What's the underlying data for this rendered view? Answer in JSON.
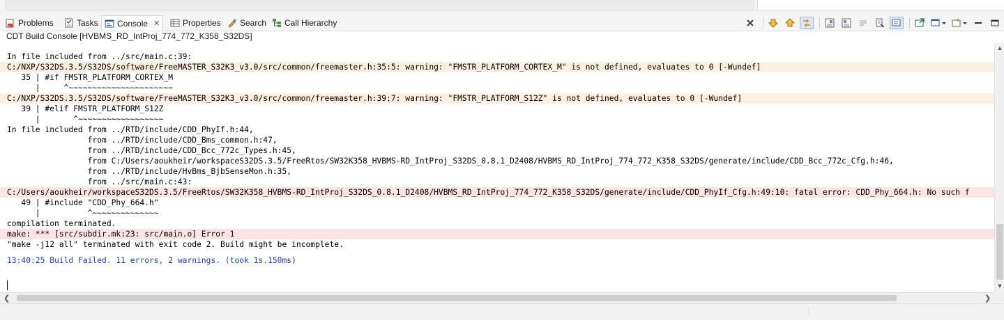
{
  "tabs": [
    {
      "label": "Problems",
      "icon": "problems-icon"
    },
    {
      "label": "Tasks",
      "icon": "tasks-icon"
    },
    {
      "label": "Console",
      "icon": "console-icon",
      "active": true
    },
    {
      "label": "Properties",
      "icon": "properties-icon"
    },
    {
      "label": "Search",
      "icon": "search-icon"
    },
    {
      "label": "Call Hierarchy",
      "icon": "call-hierarchy-icon"
    }
  ],
  "console_title": "CDT Build Console [HVBMS_RD_IntProj_774_772_K358_S32DS]",
  "toolbar_icons": [
    "close-icon",
    "previous-error-icon",
    "next-error-icon",
    "link-icon",
    "scroll-lock-icon",
    "word-wrap-icon",
    "pin-icon",
    "copy-icon",
    "clear-icon",
    "display-selected-icon",
    "open-console-icon",
    "new-console-icon",
    "minimize-icon",
    "maximize-icon"
  ],
  "colors": {
    "warning_bg": "#fdf0e0",
    "error_bg": "#fde4e4",
    "info_text": "#1c3fc8"
  },
  "console_lines": [
    {
      "text": "In file included from ../src/main.c:39:",
      "kind": "normal"
    },
    {
      "text": "C:/NXP/S32DS.3.5/S32DS/software/FreeMASTER_S32K3_v3.0/src/common/freemaster.h:35:5: warning: \"FMSTR_PLATFORM_CORTEX_M\" is not defined, evaluates to 0 [-Wundef]",
      "kind": "warning"
    },
    {
      "text": "   35 | #if FMSTR_PLATFORM_CORTEX_M",
      "kind": "normal"
    },
    {
      "text": "      |     ^~~~~~~~~~~~~~~~~~~~~~~",
      "kind": "normal"
    },
    {
      "text": "C:/NXP/S32DS.3.5/S32DS/software/FreeMASTER_S32K3_v3.0/src/common/freemaster.h:39:7: warning: \"FMSTR_PLATFORM_S12Z\" is not defined, evaluates to 0 [-Wundef]",
      "kind": "warning"
    },
    {
      "text": "   39 | #elif FMSTR_PLATFORM_S12Z",
      "kind": "normal"
    },
    {
      "text": "      |       ^~~~~~~~~~~~~~~~~~~",
      "kind": "normal"
    },
    {
      "text": "In file included from ../RTD/include/CDD_PhyIf.h:44,",
      "kind": "normal"
    },
    {
      "text": "                 from ../RTD/include/CDD_Bms_common.h:47,",
      "kind": "normal"
    },
    {
      "text": "                 from ../RTD/include/CDD_Bcc_772c_Types.h:45,",
      "kind": "normal"
    },
    {
      "text": "                 from C:/Users/aoukheir/workspaceS32DS.3.5/FreeRtos/SW32K358_HVBMS-RD_IntProj_S32DS_0.8.1_D2408/HVBMS_RD_IntProj_774_772_K358_S32DS/generate/include/CDD_Bcc_772c_Cfg.h:46,",
      "kind": "normal"
    },
    {
      "text": "                 from ../RTD/include/HvBms_BjbSenseMon.h:35,",
      "kind": "normal"
    },
    {
      "text": "                 from ../src/main.c:43:",
      "kind": "normal"
    },
    {
      "text": "C:/Users/aoukheir/workspaceS32DS.3.5/FreeRtos/SW32K358_HVBMS-RD_IntProj_S32DS_0.8.1_D2408/HVBMS_RD_IntProj_774_772_K358_S32DS/generate/include/CDD_PhyIf_Cfg.h:49:10: fatal error: CDD_Phy_664.h: No such f",
      "kind": "error"
    },
    {
      "text": "   49 | #include \"CDD_Phy_664.h\"",
      "kind": "normal"
    },
    {
      "text": "      |          ^~~~~~~~~~~~~~~",
      "kind": "normal"
    },
    {
      "text": "compilation terminated.",
      "kind": "normal"
    },
    {
      "text": "make: *** [src/subdir.mk:23: src/main.o] Error 1",
      "kind": "error"
    },
    {
      "text": "\"make -j12 all\" terminated with exit code 2. Build might be incomplete.",
      "kind": "normal"
    },
    {
      "text": "",
      "kind": "blank"
    },
    {
      "text": "13:40:25 Build Failed. 11 errors, 2 warnings. (took 1s.150ms)",
      "kind": "info"
    }
  ]
}
